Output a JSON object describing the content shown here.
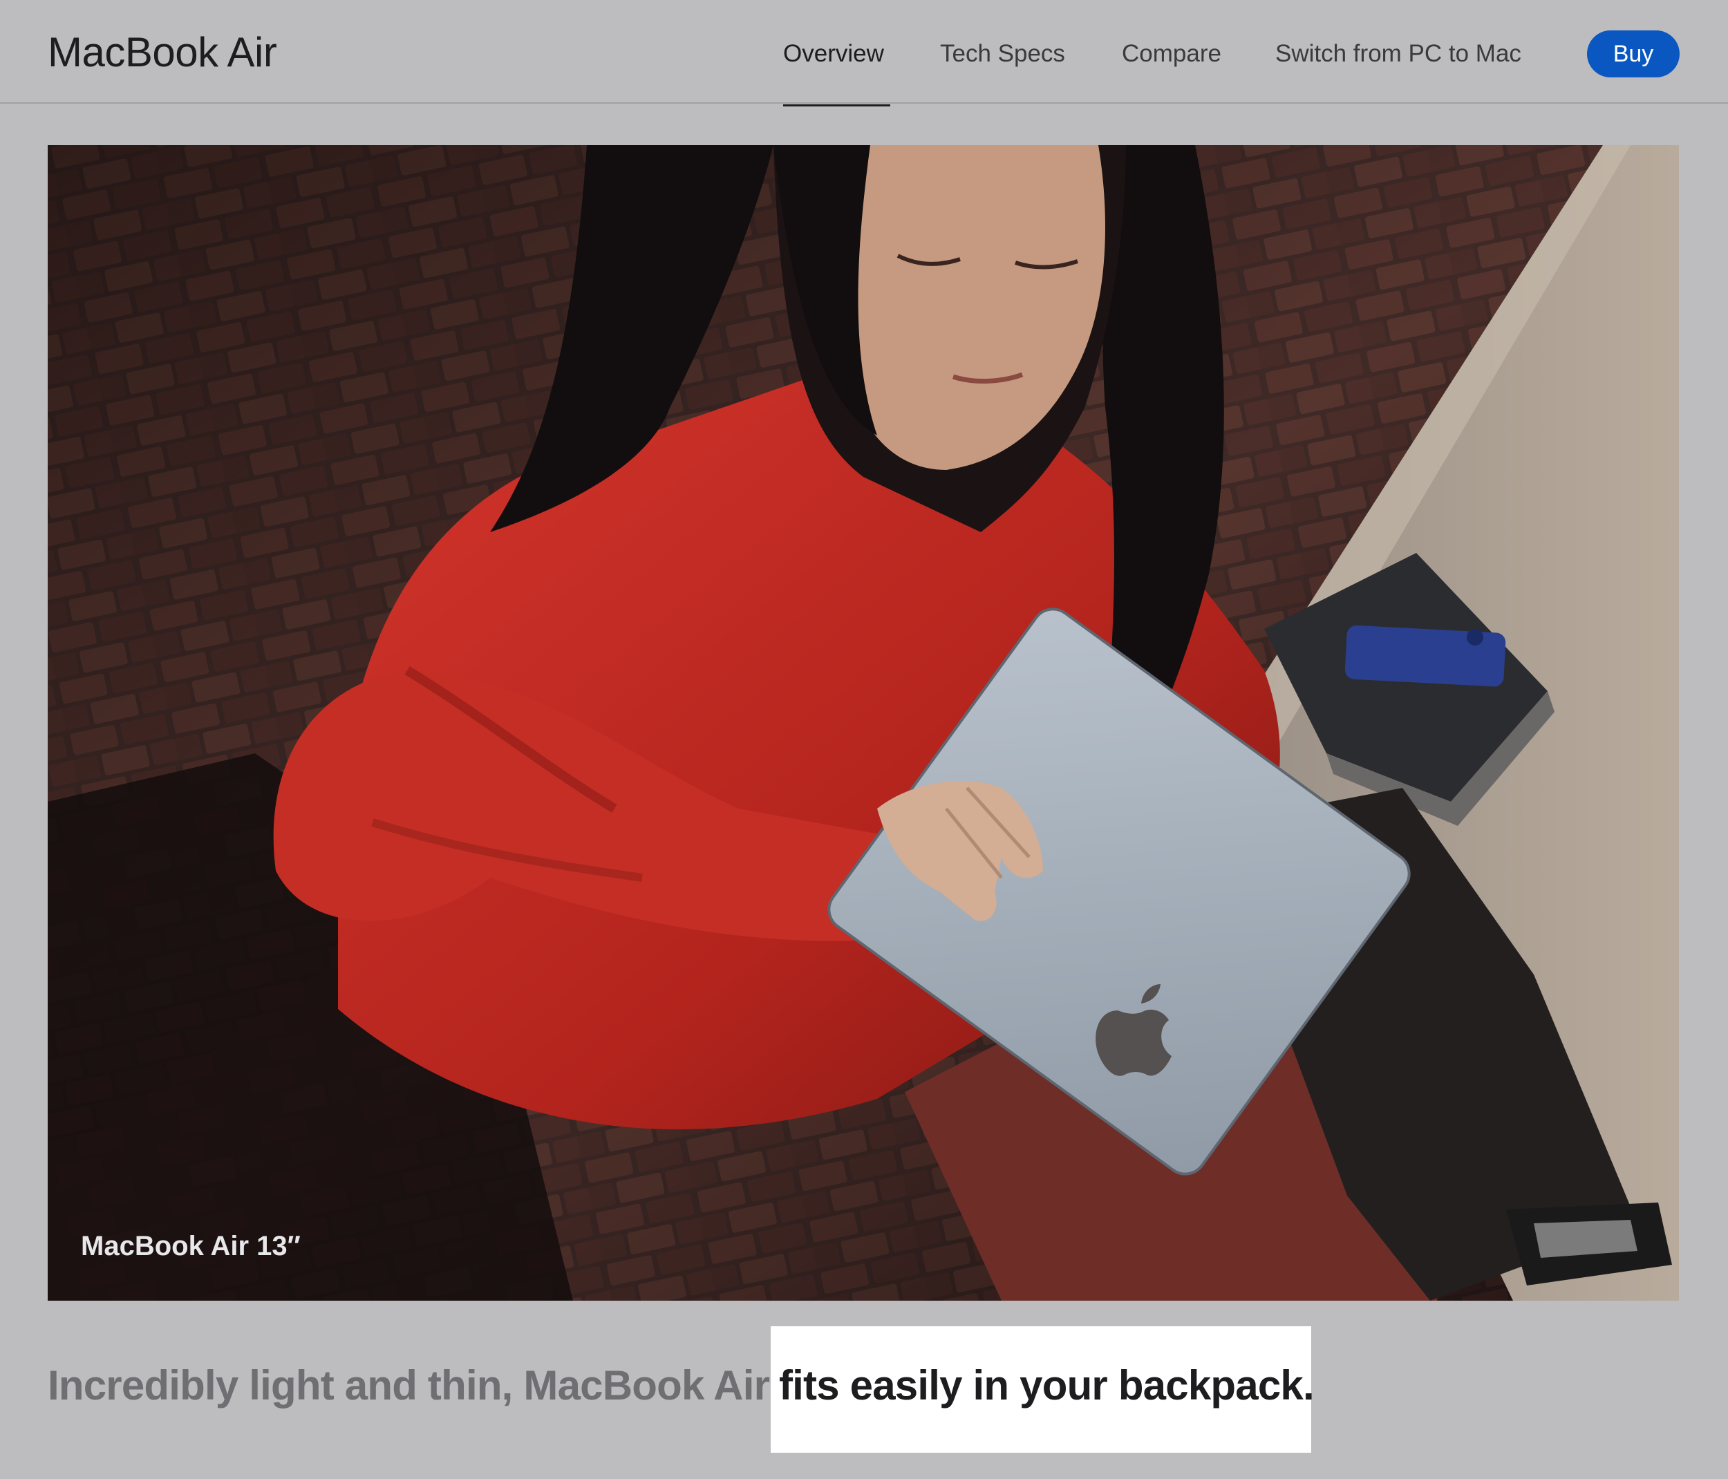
{
  "nav": {
    "brand": "MacBook Air",
    "links": [
      "Overview",
      "Tech Specs",
      "Compare",
      "Switch from PC to Mac"
    ],
    "active": "Overview",
    "buy_label": "Buy"
  },
  "hero": {
    "caption": "MacBook Air 13″"
  },
  "headline": {
    "muted": "Incredibly light and thin, MacBook Air",
    "emphasis": "fits easily in your backpack."
  },
  "colors": {
    "page_bg": "#bdbdbf",
    "buy_button": "#0a57c2",
    "text_primary": "#1d1d1f",
    "text_muted": "#6e6e73",
    "highlight": "#ffffff"
  }
}
